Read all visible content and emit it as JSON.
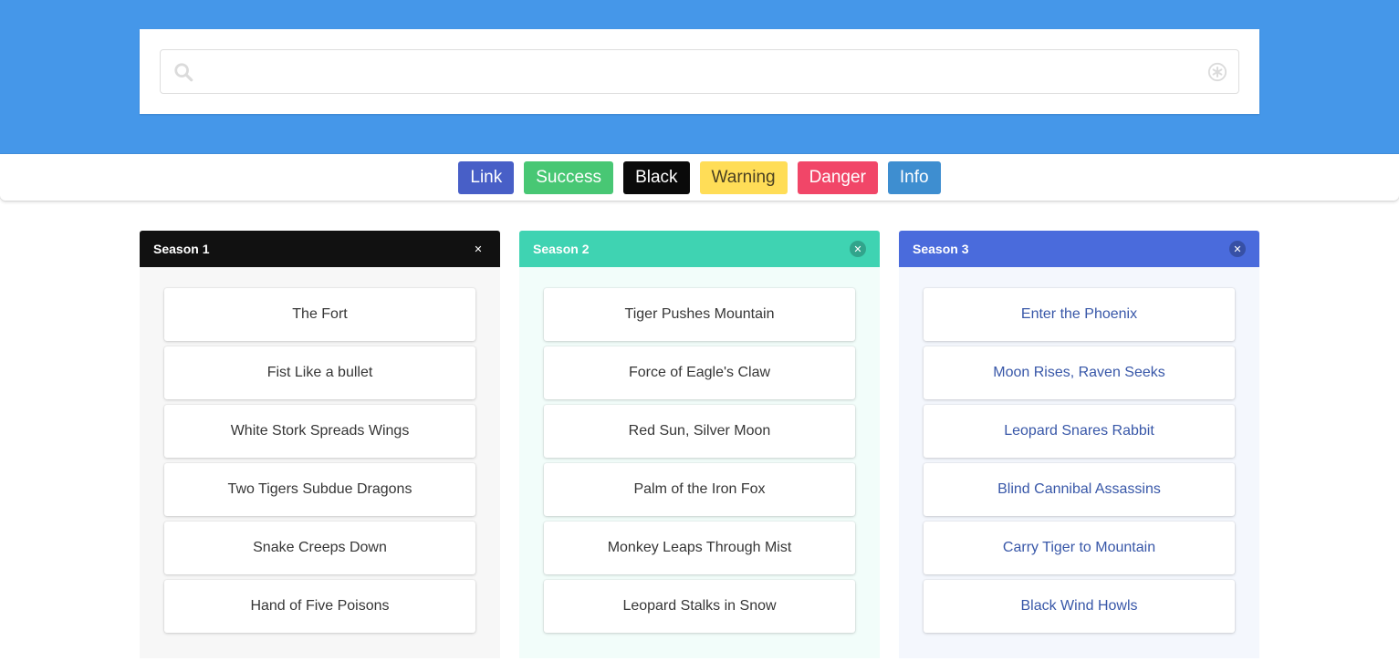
{
  "search": {
    "value": "",
    "placeholder": ""
  },
  "tags": [
    {
      "label": "Link",
      "bg": "#485fc7",
      "fg": "#ffffff"
    },
    {
      "label": "Success",
      "bg": "#48c774",
      "fg": "#ffffff"
    },
    {
      "label": "Black",
      "bg": "#0a0a0a",
      "fg": "#ffffff"
    },
    {
      "label": "Warning",
      "bg": "#ffdd57",
      "fg": "#4a4022"
    },
    {
      "label": "Danger",
      "bg": "#f14668",
      "fg": "#ffffff"
    },
    {
      "label": "Info",
      "bg": "#3e8ed0",
      "fg": "#ffffff"
    }
  ],
  "columns": [
    {
      "title": "Season 1",
      "header_bg": "#111111",
      "body_bg": "#f7f7f7",
      "text_color": "#363636",
      "items": [
        "The Fort",
        "Fist Like a bullet",
        "White Stork Spreads Wings",
        "Two Tigers Subdue Dragons",
        "Snake Creeps Down",
        "Hand of Five Poisons"
      ]
    },
    {
      "title": "Season 2",
      "header_bg": "#3fd3b2",
      "body_bg": "#f2fdfa",
      "text_color": "#363636",
      "items": [
        "Tiger Pushes Mountain",
        "Force of Eagle's Claw",
        "Red Sun, Silver Moon",
        "Palm of the Iron Fox",
        "Monkey Leaps Through Mist",
        "Leopard Stalks in Snow"
      ]
    },
    {
      "title": "Season 3",
      "header_bg": "#4a6bdc",
      "body_bg": "#f4f7fd",
      "text_color": "#3857a8",
      "items": [
        "Enter the Phoenix",
        "Moon Rises, Raven Seeks",
        "Leopard Snares Rabbit",
        "Blind Cannibal Assassins",
        "Carry Tiger to Mountain",
        "Black Wind Howls"
      ]
    }
  ],
  "icons": {
    "search": "search-icon",
    "clear": "clear-icon",
    "close": "close-icon"
  },
  "colors": {
    "hero": "#4597e9"
  }
}
